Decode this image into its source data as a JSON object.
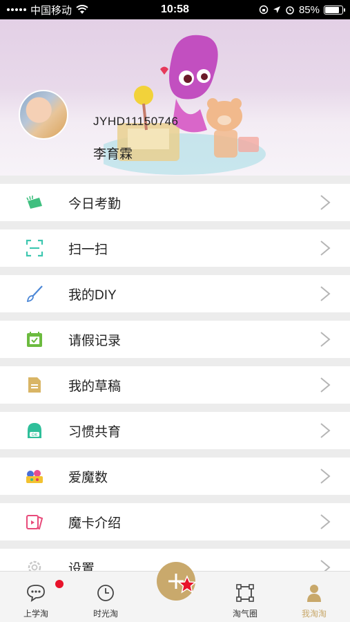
{
  "status_bar": {
    "carrier": "中国移动",
    "time": "10:58",
    "battery": "85%"
  },
  "profile": {
    "user_id": "JYHD11150746",
    "name": "李育霖"
  },
  "menu": [
    {
      "label": "今日考勤",
      "icon": "attendance-icon"
    },
    {
      "label": "扫一扫",
      "icon": "scan-icon"
    },
    {
      "label": "我的DIY",
      "icon": "brush-icon"
    },
    {
      "label": "请假记录",
      "icon": "calendar-check-icon"
    },
    {
      "label": "我的草稿",
      "icon": "draft-document-icon"
    },
    {
      "label": "习惯共育",
      "icon": "habit-ok-icon"
    },
    {
      "label": "爱魔数",
      "icon": "magic-numbers-icon"
    },
    {
      "label": "魔卡介绍",
      "icon": "magic-card-icon"
    },
    {
      "label": "设置",
      "icon": "gear-icon"
    }
  ],
  "tab_bar": {
    "tabs": [
      {
        "label": "上学淘",
        "icon": "chat-bubble-icon"
      },
      {
        "label": "时光淘",
        "icon": "clock-icon"
      },
      {
        "label": "淘气圈",
        "icon": "frame-icon"
      },
      {
        "label": "我淘淘",
        "icon": "person-icon"
      }
    ],
    "center_icon": "plus-icon",
    "active_color": "#c8a86a",
    "accent_color": "#c9a96c"
  }
}
